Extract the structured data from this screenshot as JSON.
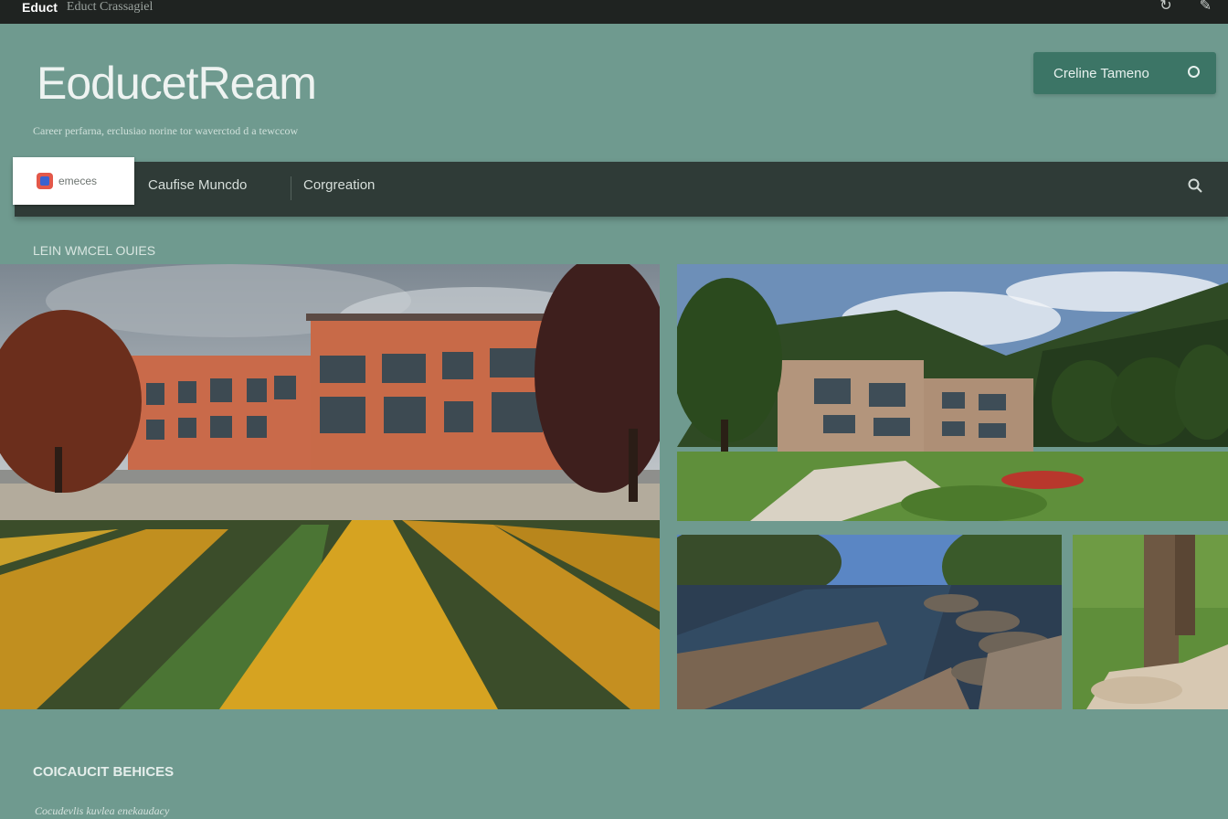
{
  "topbar": {
    "brand": "Educt",
    "subbrand": "Educt Crassagiel",
    "icon_left": "refresh-icon",
    "icon_right": "edit-icon"
  },
  "hero": {
    "title": "EoducetReam",
    "subtitle": "Career perfarna, erclusiao norine tor waverctod d a tewccow"
  },
  "cta": {
    "label": "Creline Tameno",
    "icon": "search-icon",
    "color": "#3c7566"
  },
  "nav": {
    "active_label": "emeces",
    "items": [
      {
        "label": "Caufise Muncdo"
      },
      {
        "label": "Corgreation"
      }
    ],
    "search_icon": "search-icon",
    "bar_color": "#2f3b37"
  },
  "gallery": {
    "label": "LEIN WMCEL OUIES",
    "tiles": [
      {
        "name": "campus-building-tulips"
      },
      {
        "name": "campus-building-hills"
      },
      {
        "name": "river-wooden-pier"
      },
      {
        "name": "grass-stone-sculpture"
      }
    ]
  },
  "footer": {
    "title": "COICAUCIT BEHICES",
    "subtitle": "Cocudevlis kuvlea enekaudacy"
  },
  "colors": {
    "page_background": "#6f9a8f",
    "topbar": "#1f2321"
  }
}
